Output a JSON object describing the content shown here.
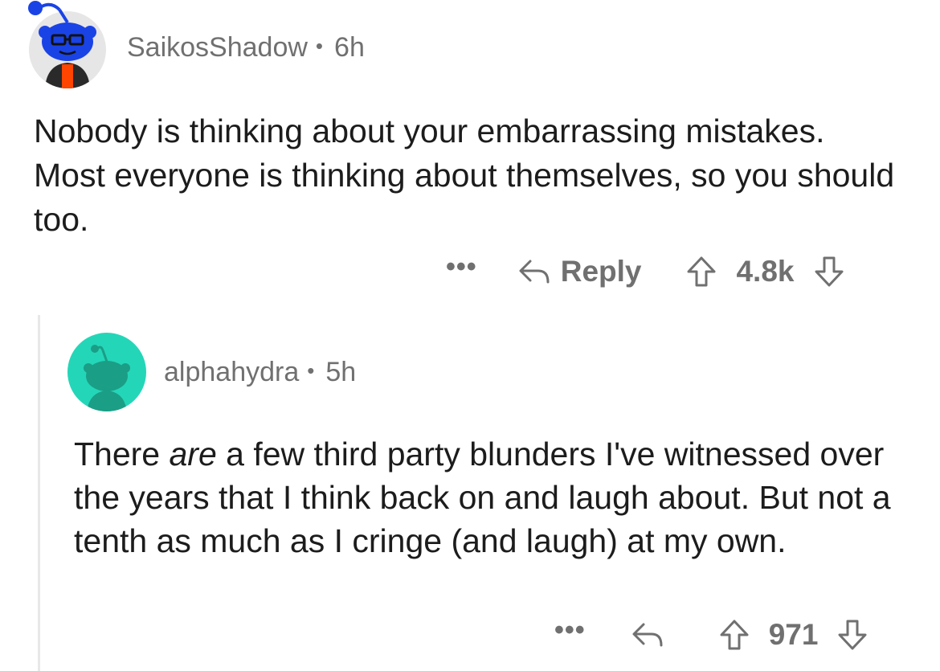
{
  "comments": [
    {
      "username": "SaikosShadow",
      "separator": "•",
      "age": "6h",
      "avatar_icon": "snoo-glasses-avatar-icon",
      "body": "Nobody is thinking about your embarrassing mistakes. Most everyone is thinking about themselves, so you should too.",
      "actions": {
        "more_label": "•••",
        "reply_label": "Reply",
        "upvote_icon": "upvote-arrow-icon",
        "score": "4.8k",
        "downvote_icon": "downvote-arrow-icon"
      }
    },
    {
      "username": "alphahydra",
      "separator": "•",
      "age": "5h",
      "avatar_icon": "snoo-default-avatar-icon",
      "body_before_emphasis": "There ",
      "body_emphasis": "are",
      "body_after_emphasis": " a few third party blunders I've witnessed over the years that I think back on and laugh about. But not a tenth as much as I cringe (and laugh) at my own.",
      "actions": {
        "more_label": "•••",
        "reply_icon": "reply-arrow-icon",
        "upvote_icon": "upvote-arrow-icon",
        "score": "971",
        "downvote_icon": "downvote-arrow-icon"
      }
    }
  ],
  "colors": {
    "text_primary": "#1c1c1c",
    "text_meta": "#707070",
    "avatar1_bg": "#e6e6e6",
    "avatar1_snoo": "#1a43e6",
    "avatar1_shirt": "#ff4500",
    "avatar2_bg": "#24d6b8",
    "avatar2_snoo": "#1b9e86",
    "thread_line": "#e8e8e8"
  }
}
